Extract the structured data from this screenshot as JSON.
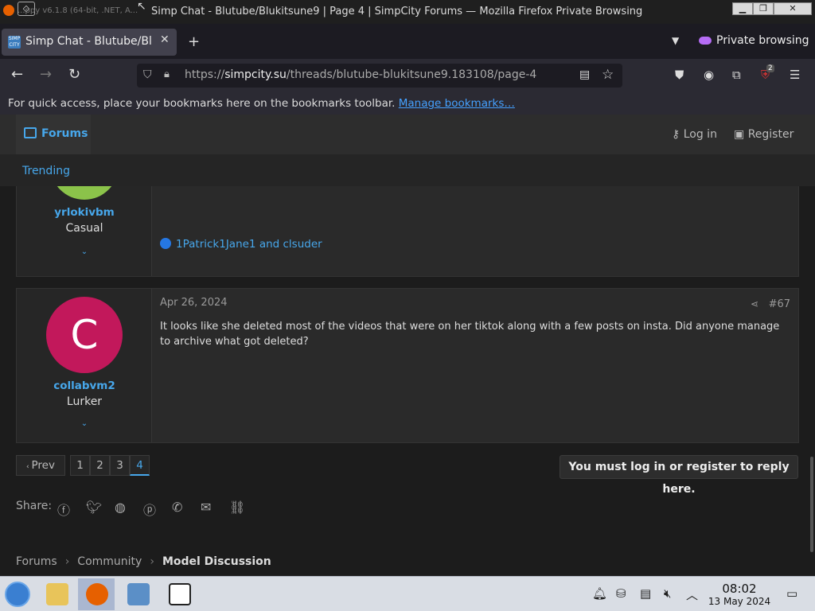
{
  "window": {
    "title": "Simp Chat - Blutube/Blukitsune9 | Page 4 | SimpCity Forums — Mozilla Firefox Private Browsing",
    "ghost_text": "...ppy v6.1.8 (64-bit, .NET, A..."
  },
  "tabs": [
    {
      "label": "Simp Chat - Blutube/Blukitsune9",
      "favicon_text": "SIMP CITY"
    }
  ],
  "private_label": "Private browsing",
  "address": {
    "prefix": "https://",
    "host": "simpcity.su",
    "path": "/threads/blutube-blukitsune9.183108/page-4"
  },
  "extension_badge": "2",
  "bookmarks": {
    "text": "For quick access, place your bookmarks here on the bookmarks toolbar. ",
    "link": "Manage bookmarks…"
  },
  "site_nav": {
    "forums": "Forums",
    "login": "Log in",
    "register": "Register",
    "trending": "Trending"
  },
  "posts": [
    {
      "username": "yrlokivbm",
      "rank": "Casual",
      "reactions": "1Patrick1Jane1 and clsuder",
      "avatar_color": "#8bc34a"
    },
    {
      "username": "collabvm2",
      "rank": "Lurker",
      "avatar_letter": "C",
      "avatar_color": "#c2185b",
      "date": "Apr 26, 2024",
      "number": "#67",
      "message": "It looks like she deleted most of the videos that were on her tiktok along with a few posts on insta. Did anyone manage to archive what got deleted?"
    }
  ],
  "pagination": {
    "prev": "Prev",
    "pages": [
      "1",
      "2",
      "3",
      "4"
    ],
    "current": "4"
  },
  "reply_notice": "You must log in or register to reply here.",
  "share_label": "Share:",
  "share_icons": [
    "facebook-icon",
    "twitter-icon",
    "reddit-icon",
    "pinterest-icon",
    "whatsapp-icon",
    "email-icon",
    "link-icon"
  ],
  "breadcrumb": [
    "Forums",
    "Community",
    "Model Discussion"
  ],
  "clock": {
    "time": "08:02",
    "date": "13 May 2024"
  },
  "colors": {
    "accent": "#47a7eb",
    "bg": "#1c1c1c",
    "post_bg": "#2a2a2a"
  }
}
